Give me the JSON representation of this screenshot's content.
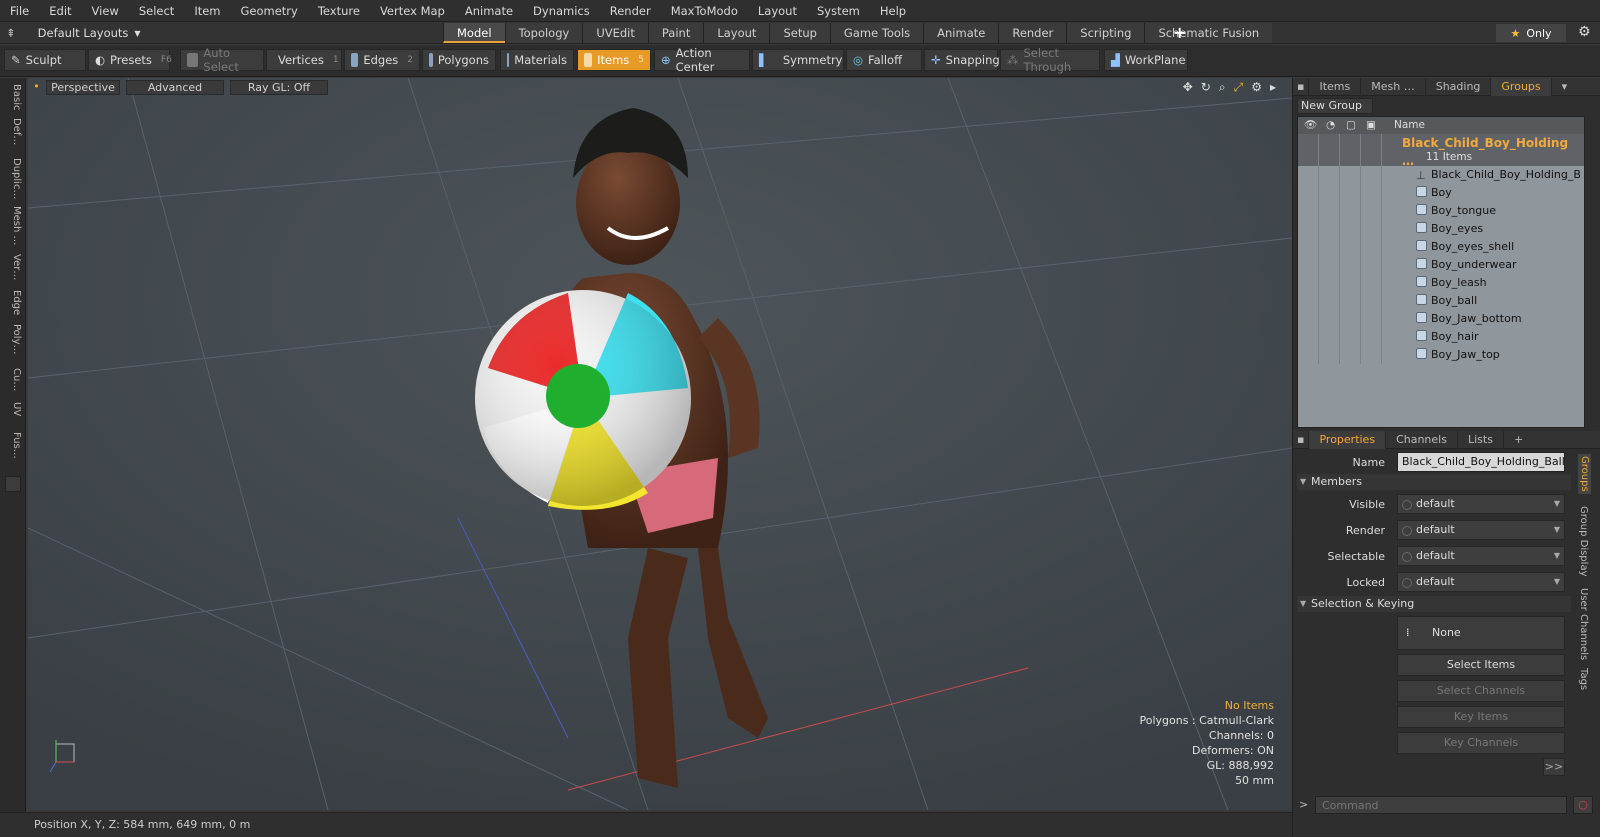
{
  "menu": [
    "File",
    "Edit",
    "View",
    "Select",
    "Item",
    "Geometry",
    "Texture",
    "Vertex Map",
    "Animate",
    "Dynamics",
    "Render",
    "MaxToModo",
    "Layout",
    "System",
    "Help"
  ],
  "layout_selector": "Default Layouts",
  "layout_tabs": [
    "Model",
    "Topology",
    "UVEdit",
    "Paint",
    "Layout",
    "Setup",
    "Game Tools",
    "Animate",
    "Render",
    "Scripting",
    "Schematic Fusion"
  ],
  "only_label": "Only",
  "toolbar": {
    "sculpt": "Sculpt",
    "presets": "Presets",
    "presets_key": "F6",
    "auto_select": "Auto Select",
    "vertices": "Vertices",
    "vertices_key": "1",
    "edges": "Edges",
    "edges_key": "2",
    "polygons": "Polygons",
    "materials": "Materials",
    "items": "Items",
    "items_key": "5",
    "action_center": "Action Center",
    "symmetry": "Symmetry",
    "falloff": "Falloff",
    "snapping": "Snapping",
    "select_through": "Select Through",
    "workplane": "WorkPlane"
  },
  "left_tabs": [
    "Basic",
    "Def…",
    "Duplic…",
    "Mesh …",
    "Ver…",
    "Edge",
    "Poly…",
    "Cu…",
    "UV",
    "Fus…"
  ],
  "viewport": {
    "view": "Perspective",
    "shading": "Advanced",
    "raygl": "Ray GL: Off",
    "info": {
      "items": "No Items",
      "polygons": "Polygons : Catmull-Clark",
      "channels": "Channels: 0",
      "deformers": "Deformers: ON",
      "gl": "GL: 888,992",
      "scale": "50 mm"
    }
  },
  "status": "Position X, Y, Z:   584 mm, 649 mm, 0 m",
  "groups_panel": {
    "tabs": [
      "Items",
      "Mesh …",
      "Shading",
      "Groups"
    ],
    "new_group": "New Group",
    "name_header": "Name",
    "group_name": "Black_Child_Boy_Holding …",
    "group_count": "11 Items",
    "items": [
      "Black_Child_Boy_Holding_B …",
      "Boy",
      "Boy_tongue",
      "Boy_eyes",
      "Boy_eyes_shell",
      "Boy_underwear",
      "Boy_leash",
      "Boy_ball",
      "Boy_Jaw_bottom",
      "Boy_hair",
      "Boy_Jaw_top"
    ]
  },
  "props_panel": {
    "tabs": [
      "Properties",
      "Channels",
      "Lists"
    ],
    "name_label": "Name",
    "name_value": "Black_Child_Boy_Holding_Ball_Be…",
    "members": "Members",
    "visible": "Visible",
    "render": "Render",
    "selectable": "Selectable",
    "locked": "Locked",
    "default": "default",
    "sel_keying": "Selection & Keying",
    "none": "None",
    "select_items": "Select Items",
    "select_channels": "Select Channels",
    "key_items": "Key Items",
    "key_channels": "Key Channels",
    "more": ">>",
    "side_tabs": [
      "Groups",
      "Group Display",
      "User Channels",
      "Tags"
    ]
  },
  "command_placeholder": "Command",
  "colors": {
    "accent": "#e79a26",
    "selected_text": "#f3a93c"
  }
}
